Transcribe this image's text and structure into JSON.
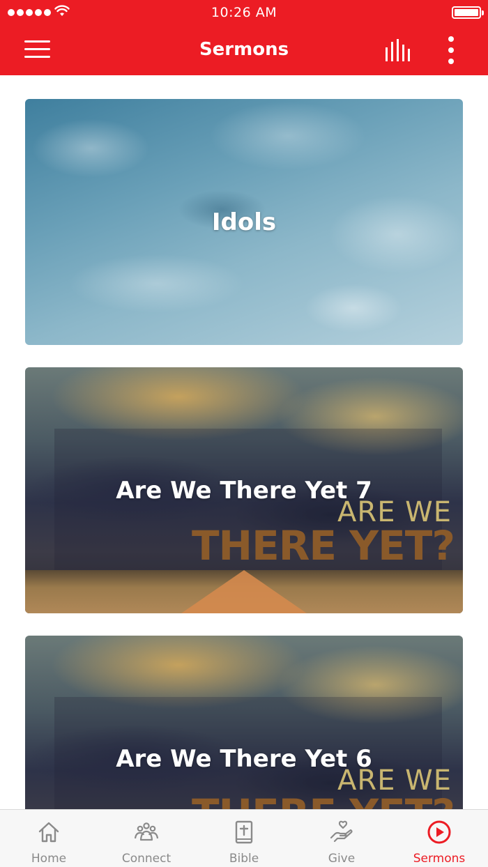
{
  "status": {
    "time": "10:26 AM"
  },
  "header": {
    "title": "Sermons"
  },
  "sermons": [
    {
      "title": "Idols"
    },
    {
      "title": "Are We There Yet 7",
      "art_line1": "ARE WE",
      "art_line2": "THERE YET?"
    },
    {
      "title": "Are We There Yet 6",
      "art_line1": "ARE WE",
      "art_line2": "THERE YET?"
    }
  ],
  "tabs": [
    {
      "label": "Home",
      "icon": "home-icon"
    },
    {
      "label": "Connect",
      "icon": "connect-icon"
    },
    {
      "label": "Bible",
      "icon": "bible-icon"
    },
    {
      "label": "Give",
      "icon": "give-icon"
    },
    {
      "label": "Sermons",
      "icon": "play-circle-icon",
      "active": true
    }
  ],
  "colors": {
    "brand": "#ec1c24",
    "tab_inactive": "#8a8a8a"
  }
}
